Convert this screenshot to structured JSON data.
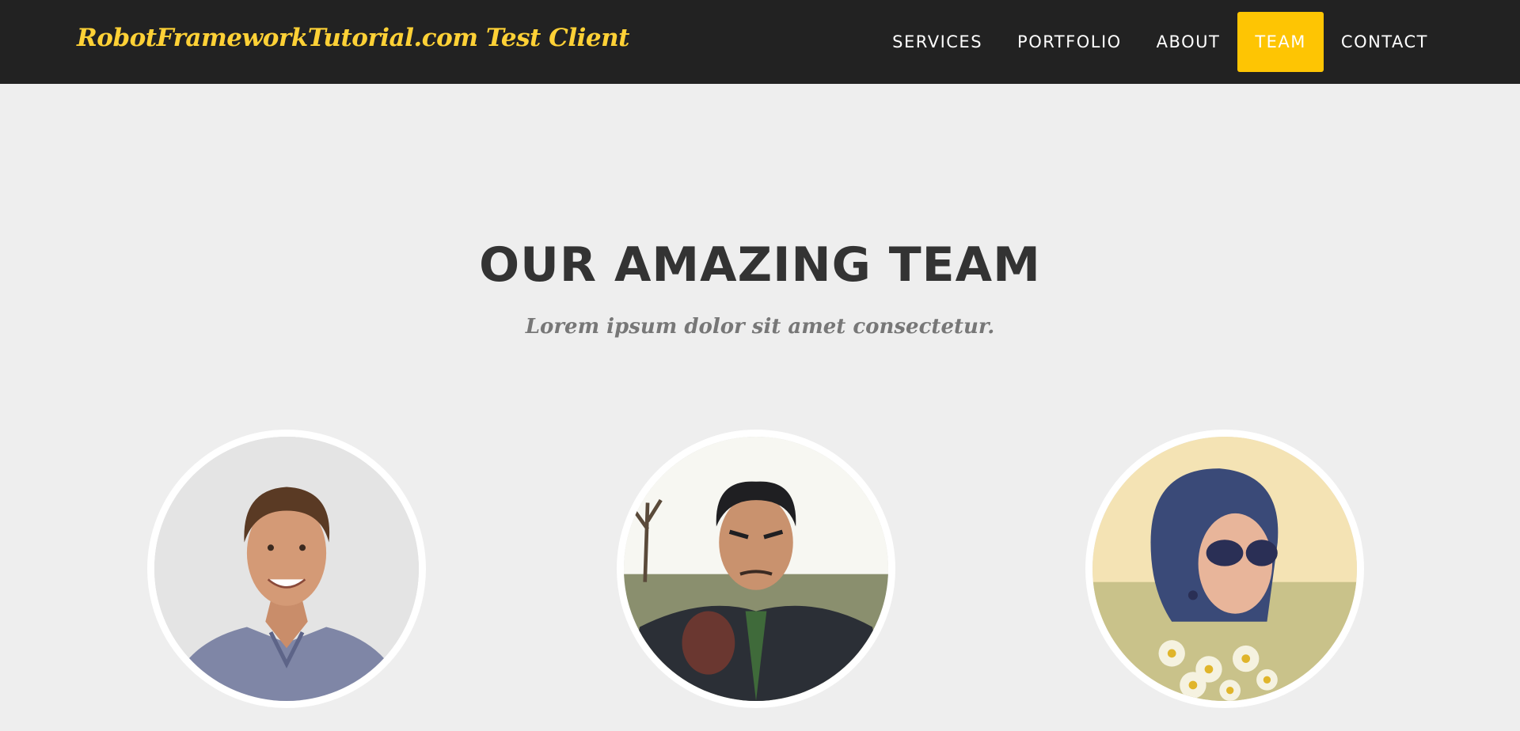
{
  "navbar": {
    "brand": "RobotFrameworkTutorial.com Test Client",
    "items": [
      {
        "label": "Services"
      },
      {
        "label": "Portfolio"
      },
      {
        "label": "About"
      },
      {
        "label": "Team"
      },
      {
        "label": "Contact"
      }
    ],
    "active_item": "Team"
  },
  "team": {
    "heading": "OUR AMAZING TEAM",
    "subheading": "Lorem ipsum dolor sit amet consectetur.",
    "members": [
      {
        "photo": "man-smiling-blue-shirt-photo"
      },
      {
        "photo": "man-leather-jacket-pointing-photo"
      },
      {
        "photo": "woman-sunglasses-flowers-photo"
      }
    ]
  },
  "colors": {
    "navbar_bg": "#222222",
    "brand": "#fed136",
    "accent": "#fec503",
    "page_bg": "#eeeeee",
    "heading": "#333333",
    "subheading": "#777777"
  }
}
